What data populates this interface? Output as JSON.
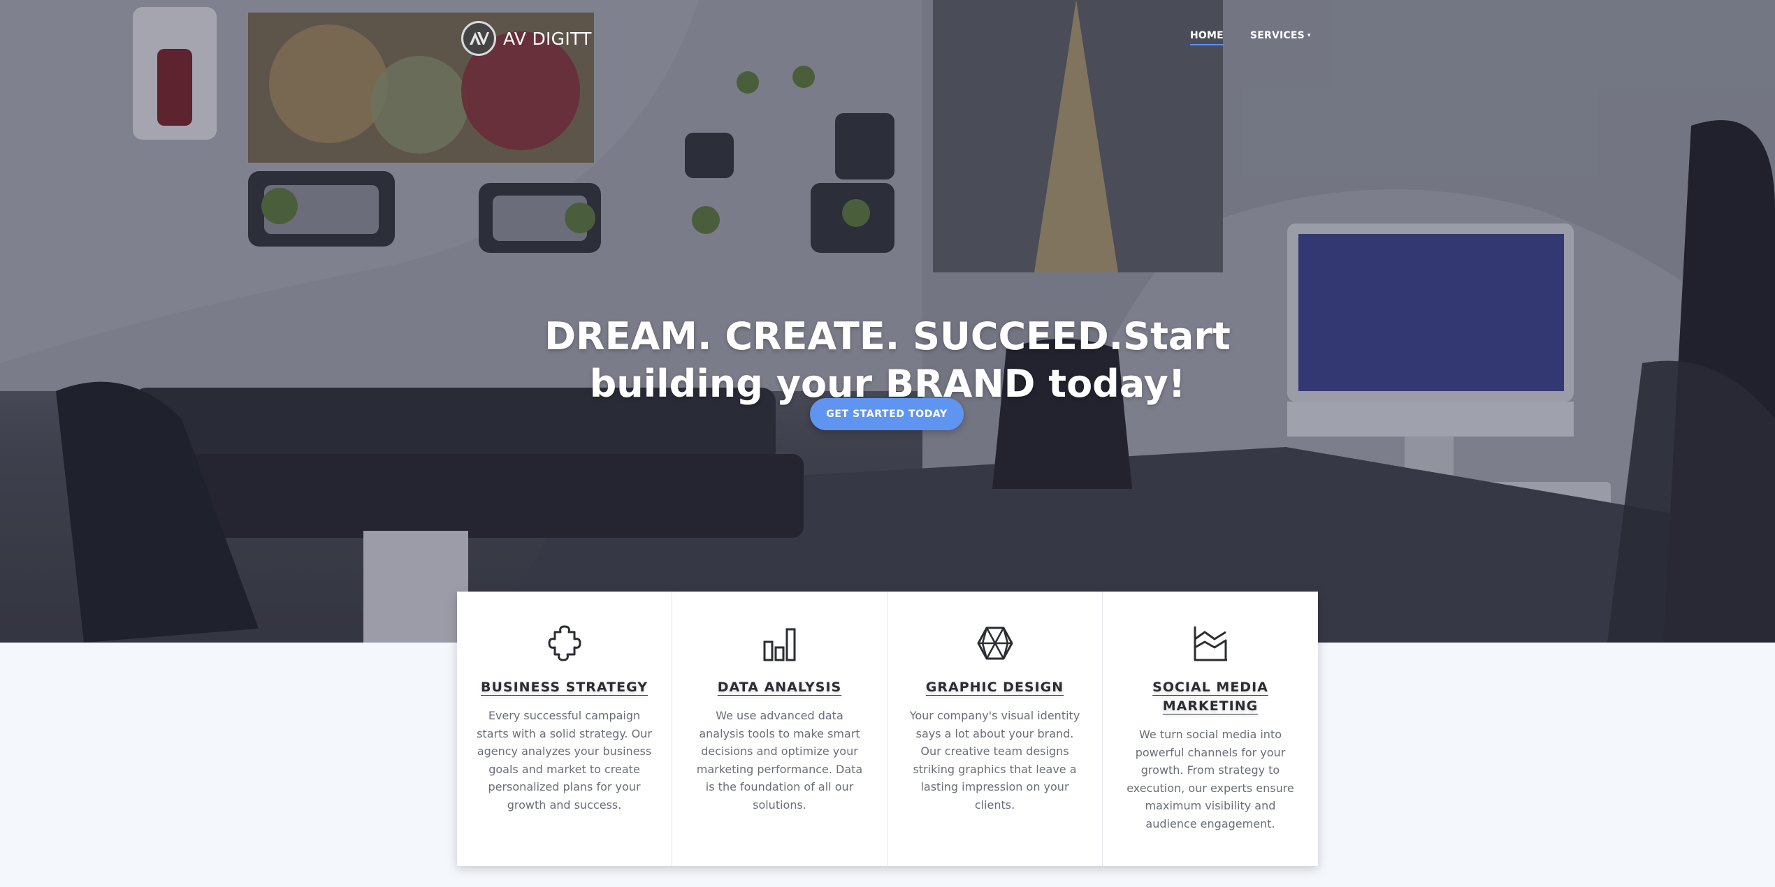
{
  "brand": {
    "name": "AV DIGITT",
    "logo_icon": "av-logo-mark"
  },
  "nav": {
    "items": [
      {
        "label": "HOME",
        "active": true
      },
      {
        "label": "SERVICES",
        "has_dropdown": true
      }
    ]
  },
  "hero": {
    "headline": "DREAM. CREATE. SUCCEED.Start building your BRAND today!",
    "cta_label": "GET STARTED TODAY"
  },
  "features": [
    {
      "icon": "puzzle-icon",
      "title": "BUSINESS STRATEGY",
      "text": "Every successful campaign starts with a solid strategy. Our agency analyzes your business goals and market to create personalized plans for your growth and success."
    },
    {
      "icon": "bar-chart-icon",
      "title": "DATA ANALYSIS",
      "text": "We use advanced data analysis tools to make smart decisions and optimize your marketing performance. Data is the foundation of all our solutions."
    },
    {
      "icon": "polygon-mesh-icon",
      "title": "GRAPHIC DESIGN",
      "text": "Your company's visual identity says a lot about your brand. Our creative team designs striking graphics that leave a lasting impression on your clients."
    },
    {
      "icon": "area-chart-icon",
      "title": "SOCIAL MEDIA MARKETING",
      "text": "We turn social media into powerful channels for your growth. From strategy to execution, our experts ensure maximum visibility and audience engagement."
    }
  ],
  "colors": {
    "accent": "#5f95f1",
    "page_background": "#f4f7fc",
    "card_background": "#ffffff",
    "heading_text": "#2b2d33",
    "body_text": "#6a6e78"
  }
}
